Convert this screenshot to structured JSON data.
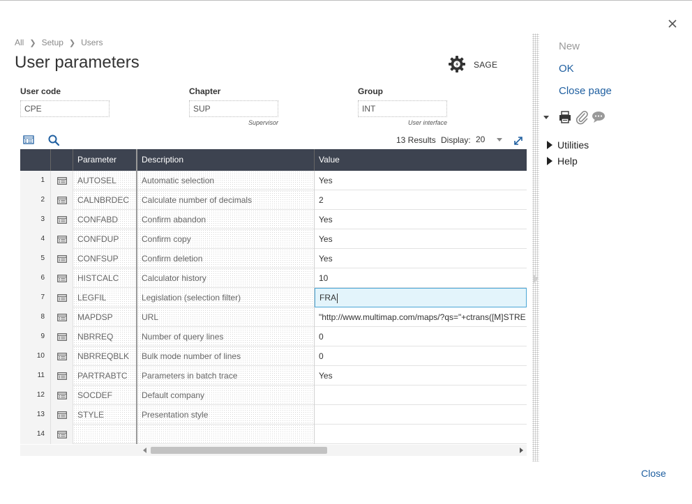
{
  "breadcrumb": [
    "All",
    "Setup",
    "Users"
  ],
  "page_title": "User parameters",
  "sage_label": "SAGE",
  "fields": {
    "user_code": {
      "label": "User code",
      "value": "CPE"
    },
    "chapter": {
      "label": "Chapter",
      "value": "SUP",
      "hint": "Supervisor"
    },
    "group": {
      "label": "Group",
      "value": "INT",
      "hint": "User interface"
    }
  },
  "grid": {
    "results_text": "13 Results",
    "display_label": "Display:",
    "display_value": "20",
    "columns": [
      "Parameter",
      "Description",
      "Value"
    ],
    "rows": [
      {
        "num": "1",
        "param": "AUTOSEL",
        "desc": "Automatic selection",
        "value": "Yes"
      },
      {
        "num": "2",
        "param": "CALNBRDEC",
        "desc": "Calculate number of decimals",
        "value": "2"
      },
      {
        "num": "3",
        "param": "CONFABD",
        "desc": "Confirm abandon",
        "value": "Yes"
      },
      {
        "num": "4",
        "param": "CONFDUP",
        "desc": "Confirm copy",
        "value": "Yes"
      },
      {
        "num": "5",
        "param": "CONFSUP",
        "desc": "Confirm deletion",
        "value": "Yes"
      },
      {
        "num": "6",
        "param": "HISTCALC",
        "desc": "Calculator history",
        "value": "10"
      },
      {
        "num": "7",
        "param": "LEGFIL",
        "desc": "Legislation (selection filter)",
        "value": "FRA"
      },
      {
        "num": "8",
        "param": "MAPDSP",
        "desc": "URL",
        "value": "\"http://www.multimap.com/maps/?qs=\"+ctrans([M]STRE"
      },
      {
        "num": "9",
        "param": "NBRREQ",
        "desc": "Number of query lines",
        "value": "0"
      },
      {
        "num": "10",
        "param": "NBRREQBLK",
        "desc": "Bulk mode number of lines",
        "value": "0"
      },
      {
        "num": "11",
        "param": "PARTRABTC",
        "desc": "Parameters in batch trace",
        "value": "Yes"
      },
      {
        "num": "12",
        "param": "SOCDEF",
        "desc": "Default company",
        "value": ""
      },
      {
        "num": "13",
        "param": "STYLE",
        "desc": "Presentation style",
        "value": ""
      },
      {
        "num": "14",
        "param": "",
        "desc": "",
        "value": ""
      }
    ],
    "active_row_index": 6
  },
  "right_panel": {
    "new_label": "New",
    "ok_label": "OK",
    "close_page_label": "Close page",
    "sections": [
      "Utilities",
      "Help"
    ]
  },
  "close_label": "Close",
  "icons": {
    "close": "close-icon",
    "gear": "gear-icon",
    "list": "list-view-icon",
    "search": "search-icon",
    "expand": "expand-icon",
    "row_detail": "row-detail-icon",
    "print": "print-icon",
    "attach": "attachment-icon",
    "comment": "comment-icon"
  },
  "colors": {
    "header_bg": "#3d4350",
    "link": "#1f5fa0",
    "active_cell_bg": "#e3f4fb",
    "active_cell_border": "#4aa6d6"
  }
}
